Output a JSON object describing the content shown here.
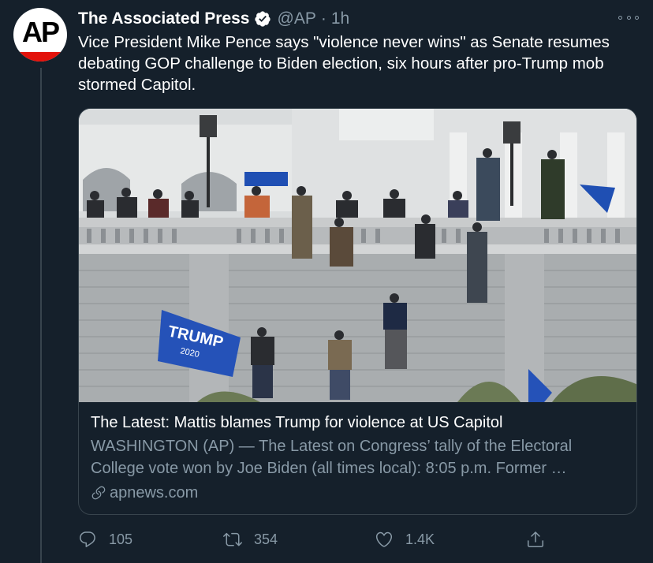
{
  "tweet": {
    "display_name": "The Associated Press",
    "handle": "@AP",
    "separator": "·",
    "time": "1h",
    "verified_icon": "verified-badge-icon",
    "avatar_text": "AP",
    "text": "Vice President Mike Pence says \"violence never wins\" as Senate resumes debating GOP challenge to Biden election, six hours after pro-Trump mob stormed Capitol."
  },
  "card": {
    "image_icon": "news-photo",
    "title": "The Latest: Mattis blames Trump for violence at US Capitol",
    "description": "WASHINGTON (AP) — The Latest on Congress’ tally of the Electoral College vote won by Joe Biden (all times local): 8:05 p.m. Former …",
    "domain": "apnews.com"
  },
  "actions": {
    "reply_count": "105",
    "retweet_count": "354",
    "like_count": "1.4K"
  },
  "colors": {
    "background": "#15202b",
    "secondary_text": "#8899a6",
    "border": "#38444d",
    "verified": "#1da1f2",
    "ap_red": "#e3120b"
  }
}
